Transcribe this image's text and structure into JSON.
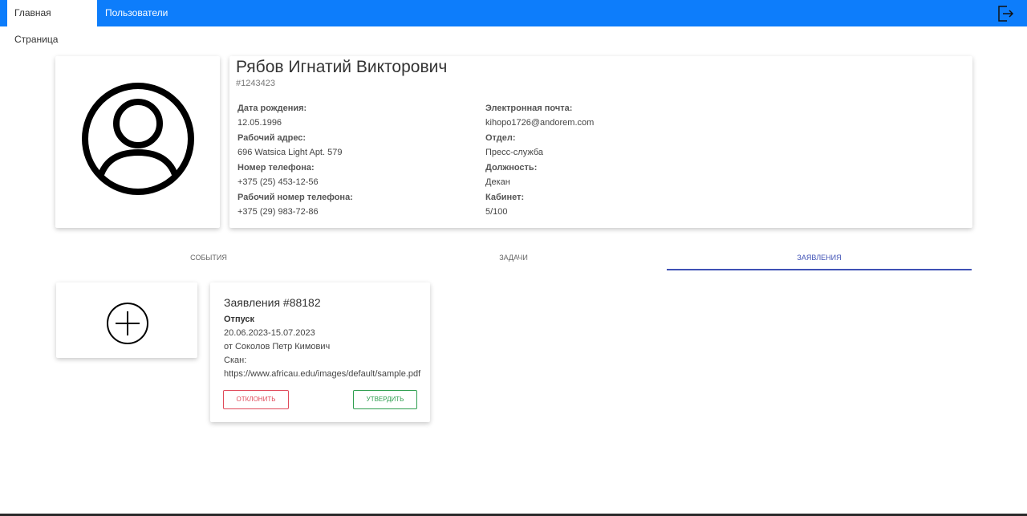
{
  "nav": {
    "home": "Главная Страница",
    "users": "Пользователи",
    "logout_icon": "logout-icon"
  },
  "profile": {
    "avatar_icon": "user-circle-icon",
    "name": "Рябов Игнатий Викторович",
    "id": "#1243423",
    "birth_label": "Дата рождения:",
    "birth_value": "12.05.1996",
    "address_label": "Рабочий адрес:",
    "address_value": "696 Watsica Light Apt. 579",
    "phone_label": "Номер телефона:",
    "phone_value": "+375 (25) 453-12-56",
    "work_phone_label": "Рабочий номер телефона:",
    "work_phone_value": "+375 (29) 983-72-86",
    "email_label": "Электронная почта:",
    "email_value": "kihopo1726@andorem.com",
    "dept_label": "Отдел:",
    "dept_value": "Пресс-служба",
    "position_label": "Должность:",
    "position_value": "Декан",
    "office_label": "Кабинет:",
    "office_value": "5/100"
  },
  "tabs": [
    {
      "label": "События",
      "active": false
    },
    {
      "label": "Задачи",
      "active": false
    },
    {
      "label": "Заявления",
      "active": true
    }
  ],
  "add_icon": "plus-circle-icon",
  "request": {
    "title": "Заявления #88182",
    "type": "Отпуск",
    "dates": "20.06.2023-15.07.2023",
    "from": "от Соколов Петр Кимович",
    "scan_label": "Скан:",
    "scan_url": "https://www.africau.edu/images/default/sample.pdf",
    "reject": "Отклонить",
    "approve": "Утвердить"
  },
  "colors": {
    "navbar": "#0d7dfb",
    "tab_active": "#3f51b5",
    "reject": "#e04a5a",
    "approve": "#2e9e4f"
  }
}
